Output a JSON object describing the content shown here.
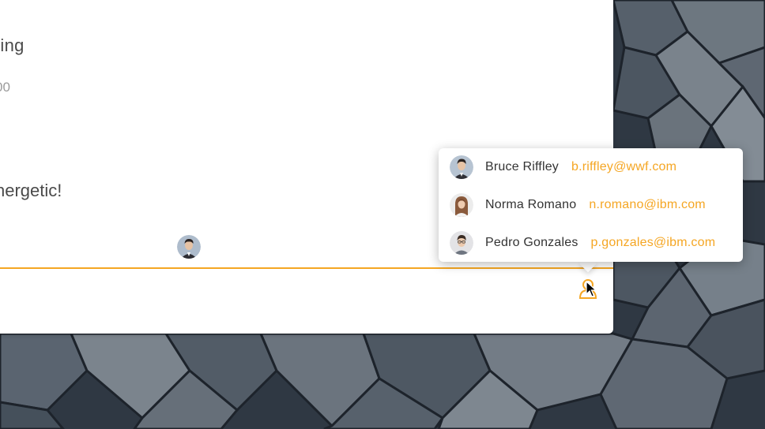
{
  "app": {
    "accent_color": "#f5a623"
  },
  "conversation": {
    "title": "ting",
    "subtitle": "00",
    "message": "nergetic!",
    "sender_avatar": "male-avatar-suit"
  },
  "composer": {
    "contacts_button_icon": "person-icon"
  },
  "contacts_popover": {
    "contacts": [
      {
        "name": "Bruce Riffley",
        "email": "b.riffley@wwf.com",
        "avatar": "male-avatar"
      },
      {
        "name": "Norma Romano",
        "email": "n.romano@ibm.com",
        "avatar": "female-avatar"
      },
      {
        "name": "Pedro Gonzales",
        "email": "p.gonzales@ibm.com",
        "avatar": "male-avatar-glasses"
      }
    ]
  }
}
